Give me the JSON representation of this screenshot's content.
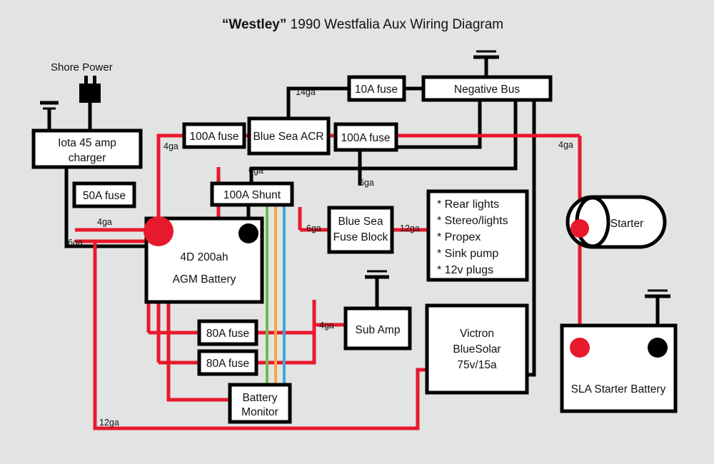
{
  "page": {
    "title_quoted": "“Westley”",
    "title_rest": " 1990 Westfalia Aux Wiring Diagram",
    "background_color": "#e2e4e3",
    "positive_wire_color": "#e8192c",
    "negative_wire_color": "#000000",
    "signal_wire_colors": [
      "#6cbe4a",
      "#f5a742",
      "#42a5d8"
    ]
  },
  "labels": {
    "shore_power": "Shore Power",
    "charger_line1": "Iota 45 amp",
    "charger_line2": "charger",
    "fuse_50a": "50A fuse",
    "fuse_100a_left": "100A fuse",
    "acr": "Blue Sea ACR",
    "fuse_100a_right": "100A fuse",
    "fuse_10a": "10A fuse",
    "negative_bus": "Negative Bus",
    "shunt": "100A Shunt",
    "battery_line1": "4D 200ah",
    "battery_line2": "AGM Battery",
    "fuse_block_line1": "Blue Sea",
    "fuse_block_line2": "Fuse Block",
    "loads": [
      "* Rear lights",
      "* Stereo/lights",
      "* Propex",
      "* Sink pump",
      "* 12v plugs"
    ],
    "starter": "Starter",
    "sla_battery": "SLA Starter Battery",
    "fuse_80a_upper": "80A fuse",
    "fuse_80a_lower": "80A fuse",
    "sub_amp": "Sub Amp",
    "battery_monitor_line1": "Battery",
    "battery_monitor_line2": "Monitor",
    "victron_line1": "Victron",
    "victron_line2": "BlueSolar",
    "victron_line3": "75v/15a"
  },
  "gauges": {
    "charger_to_battery": "4ga",
    "charger_ground": "6ga",
    "fuse100_to_battery": "4ga",
    "acr_to_10a": "14ga",
    "shunt_to_negbus": "6ga",
    "fuseblock_neg": "6ga",
    "fuseblock_pos": "6ga",
    "fuseblock_to_loads": "12ga",
    "bus_to_starter": "4ga",
    "subamp": "4ga",
    "bottom_run": "12ga"
  }
}
